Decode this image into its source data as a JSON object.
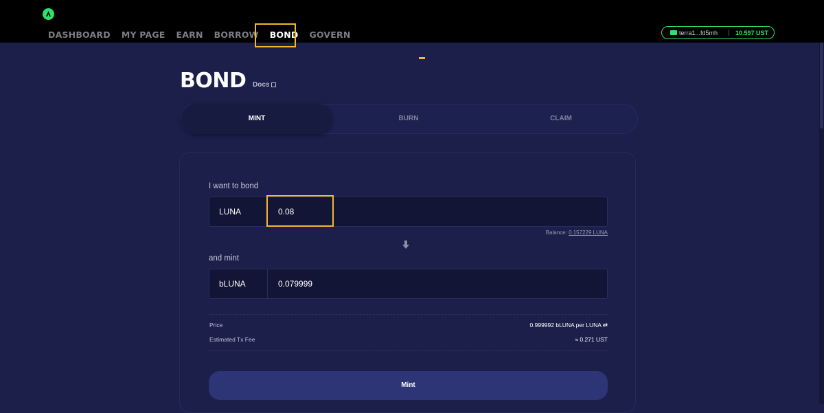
{
  "nav": {
    "items": [
      {
        "label": "DASHBOARD"
      },
      {
        "label": "MY PAGE"
      },
      {
        "label": "EARN"
      },
      {
        "label": "BORROW"
      },
      {
        "label": "BOND"
      },
      {
        "label": "GOVERN"
      }
    ],
    "active": "BOND"
  },
  "wallet": {
    "address": "terra1...fd5mh",
    "balance": "10.597 UST"
  },
  "page": {
    "title": "BOND",
    "docs_label": "Docs"
  },
  "tabs": [
    {
      "label": "MINT"
    },
    {
      "label": "BURN"
    },
    {
      "label": "CLAIM"
    }
  ],
  "form": {
    "bond_label": "I want to bond",
    "bond_token": "LUNA",
    "bond_value": "0.08",
    "balance_label": "Balance:",
    "balance_value": "0.157229 LUNA",
    "mint_label": "and mint",
    "mint_token": "bLUNA",
    "mint_value": "0.079999"
  },
  "details": {
    "price_label": "Price",
    "price_value": "0.999992 bLUNA per LUNA",
    "fee_label": "Estimated Tx Fee",
    "fee_value": "≈ 0.271 UST"
  },
  "action": {
    "mint_button": "Mint"
  },
  "colors": {
    "accent": "#2ee36b",
    "highlight": "#f5b82e",
    "background": "#1b1f4a"
  }
}
